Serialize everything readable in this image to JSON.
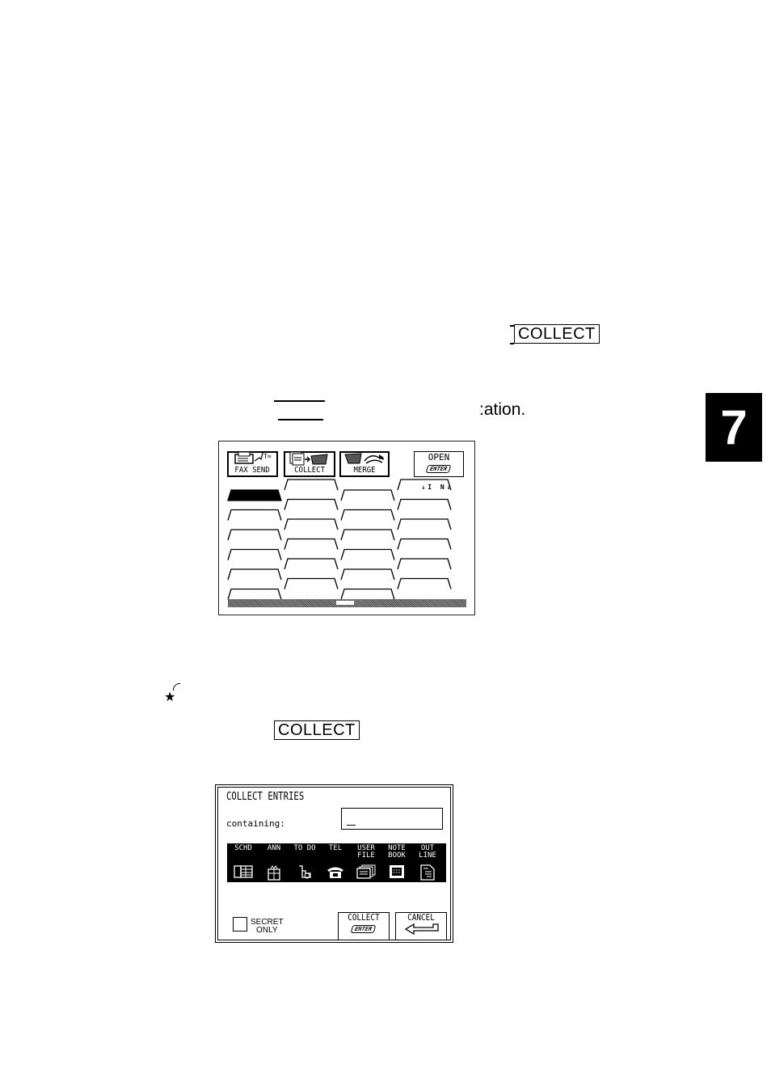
{
  "document": {
    "keycap_top": "COLLECT",
    "partial_text": ":ation.",
    "keycap_bottom": "COLLECT",
    "chapter_number": "7",
    "annotation_symbol": "★"
  },
  "filer_screen": {
    "buttons": [
      {
        "label": "FAX SEND",
        "icon": "fax-icon"
      },
      {
        "label": "COLLECT",
        "icon": "collect-icon"
      },
      {
        "label": "MERGE",
        "icon": "merge-icon"
      }
    ],
    "open_button": {
      "label": "OPEN",
      "key": "ENTER"
    },
    "index_marker": "↓I N↓",
    "folder_tabs": {
      "columns": 4,
      "rows": 6,
      "selected": "row-1-col-1"
    }
  },
  "collect_dialog": {
    "title": "COLLECT ENTRIES",
    "containing_label": "containing:",
    "containing_value": "",
    "categories": [
      {
        "label": "SCHD",
        "icon": "schedule-icon"
      },
      {
        "label": "ANN",
        "icon": "anniversary-icon"
      },
      {
        "label": "TO DO",
        "icon": "todo-icon"
      },
      {
        "label": "TEL",
        "icon": "telephone-icon"
      },
      {
        "label": "USER FILE",
        "icon": "user-file-icon"
      },
      {
        "label": "NOTE BOOK",
        "icon": "notebook-icon"
      },
      {
        "label": "OUT LINE",
        "icon": "outline-icon"
      }
    ],
    "secret_only_label_1": "SECRET",
    "secret_only_label_2": "ONLY",
    "secret_only_checked": false,
    "collect_button": {
      "label": "COLLECT",
      "key": "ENTER"
    },
    "cancel_button": {
      "label": "CANCEL"
    }
  }
}
